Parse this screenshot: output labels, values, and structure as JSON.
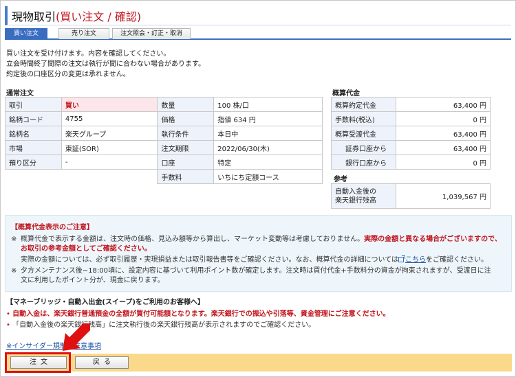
{
  "title": {
    "main": "現物取引",
    "sub": "(買い注文 / 確認)"
  },
  "tabs": [
    {
      "label": "買い注文",
      "active": true
    },
    {
      "label": "売り注文",
      "active": false
    },
    {
      "label": "注文照会・訂正・取消",
      "active": false
    }
  ],
  "intro": [
    "買い注文を受け付けます。内容を確認してください。",
    "立会時間終了間際の注文は執行が間に合わない場合があります。",
    "約定後の口座区分の変更は承れません。"
  ],
  "order": {
    "heading": "通常注文",
    "rows": [
      {
        "l1": "取引",
        "v1": "買い",
        "l2": "数量",
        "v2": "100 株/口"
      },
      {
        "l1": "銘柄コード",
        "v1": "4755",
        "l2": "価格",
        "v2": "指値 634 円"
      },
      {
        "l1": "銘柄名",
        "v1": "楽天グループ",
        "l2": "執行条件",
        "v2": "本日中"
      },
      {
        "l1": "市場",
        "v1": "東証(SOR)",
        "l2": "注文期限",
        "v2": "2022/06/30(木)"
      },
      {
        "l1": "預り区分",
        "v1": "-",
        "l2": "口座",
        "v2": "特定"
      },
      {
        "l1": "",
        "v1": "",
        "l2": "手数料",
        "v2": "いちにち定額コース"
      }
    ]
  },
  "estimate": {
    "heading": "概算代金",
    "rows": [
      {
        "label": "概算約定代金",
        "value": "63,400 円"
      },
      {
        "label": "手数料(税込)",
        "value": "0 円"
      },
      {
        "label": "概算受渡代金",
        "value": "63,400 円"
      },
      {
        "label": "証券口座から",
        "value": "63,400 円"
      },
      {
        "label": "銀行口座から",
        "value": "0 円"
      }
    ]
  },
  "reference": {
    "heading": "参考",
    "label_line1": "自動入金後の",
    "label_line2": "楽天銀行残高",
    "value": "1,039,567 円"
  },
  "notice": {
    "heading": "【概算代金表示のご注意】",
    "p1_mark": "※",
    "p1_a": "概算代金で表示する金額は、注文時の価格、見込み額等から算出し、マーケット変動等は考慮しておりません。",
    "p1_red": "実際の金額と異なる場合がございますので、お取引の参考金額としてご確認ください。",
    "p1_red_tail": "お取引の参考金額としてご確認ください。",
    "p2_a": "実際の金額については、必ず取引履歴・実現損益または取引報告書等をご確認ください。なお、概算代金の詳細については",
    "p2_link": "こちら",
    "p2_b": "をご確認ください。",
    "p3_mark": "※",
    "p3_a": "夕方メンテナンス後~18:00頃に、設定内容に基づいて利用ポイント数が確定します。注文時は買付代金+手数料分の資金が拘束されますが、受渡日に注",
    "p3_b": "文に利用したポイント分が、現金に戻ります。"
  },
  "sweep": {
    "heading": "【マネーブリッジ・自動入出金(スイープ)をご利用のお客様へ】",
    "b1": "自動入金は、楽天銀行普通預金の全額が買付可能額となります。楽天銀行での振込や引落等、資金管理にご注意ください。",
    "b2": "「自動入金後の楽天銀行残高」に注文執行後の楽天銀行残高が表示されますのでご確認ください。",
    "bullet": "•"
  },
  "insider_link": "※インサイダー規制の注意事項",
  "buttons": {
    "order": "注文",
    "back": "戻る"
  },
  "colors": {
    "accent": "#3a6cc0",
    "alert": "#c0151d",
    "highlight": "#e01010",
    "button_bar": "#fbd98a"
  }
}
